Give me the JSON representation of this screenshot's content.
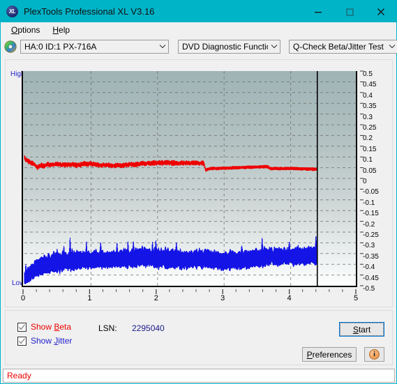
{
  "window": {
    "title": "PlexTools Professional XL V3.16",
    "icon": "XL",
    "icon_name": "plextools-app-icon",
    "accent_color": "#00b4c8",
    "controls": {
      "minimize": "minimize-icon",
      "maximize": "maximize-icon",
      "close": "close-icon"
    }
  },
  "menu": {
    "items": [
      {
        "label": "Options",
        "accel": "O"
      },
      {
        "label": "Help",
        "accel": "H"
      }
    ]
  },
  "toolbar": {
    "disc_icon": "disc-icon",
    "drive_select": {
      "value": "HA:0 ID:1  PX-716A",
      "options": [
        "HA:0 ID:1  PX-716A"
      ]
    },
    "function_select": {
      "value": "DVD Diagnostic Functions",
      "options": [
        "DVD Diagnostic Functions"
      ]
    },
    "test_select": {
      "value": "Q-Check Beta/Jitter Test",
      "options": [
        "Q-Check Beta/Jitter Test"
      ]
    }
  },
  "chart_data": {
    "type": "line",
    "title": "",
    "xlabel": "",
    "ylabel": "",
    "xlim": [
      0,
      5
    ],
    "ylim": [
      -0.5,
      0.5
    ],
    "grid": true,
    "legend": "none",
    "left_axis_labels": {
      "top": "High",
      "bottom": "Low"
    },
    "x_ticks": [
      "0",
      "1",
      "2",
      "3",
      "4",
      "5"
    ],
    "y_ticks": [
      "0.5",
      "0.45",
      "0.4",
      "0.35",
      "0.3",
      "0.25",
      "0.2",
      "0.15",
      "0.1",
      "0.05",
      "0",
      "-0.05",
      "-0.1",
      "-0.15",
      "-0.2",
      "-0.25",
      "-0.3",
      "-0.35",
      "-0.4",
      "-0.45",
      "-0.5"
    ],
    "marker_line_x": 4.4,
    "series": [
      {
        "name": "Beta",
        "color": "#ee0000",
        "x": [
          0.0,
          0.05,
          0.1,
          0.15,
          0.2,
          0.25,
          0.3,
          0.35,
          0.4,
          0.45,
          0.5,
          0.55,
          0.6,
          0.65,
          0.7,
          0.75,
          0.8,
          0.85,
          0.9,
          0.95,
          1.0,
          1.05,
          1.1,
          1.15,
          1.2,
          1.25,
          1.3,
          1.35,
          1.4,
          1.45,
          1.5,
          1.55,
          1.6,
          1.65,
          1.7,
          1.75,
          1.8,
          1.85,
          1.9,
          1.95,
          2.0,
          2.05,
          2.1,
          2.15,
          2.2,
          2.25,
          2.3,
          2.35,
          2.4,
          2.45,
          2.5,
          2.55,
          2.6,
          2.65,
          2.7,
          2.72,
          2.75,
          2.8,
          2.85,
          2.9,
          2.95,
          3.0,
          3.05,
          3.1,
          3.15,
          3.2,
          3.25,
          3.3,
          3.35,
          3.4,
          3.45,
          3.5,
          3.55,
          3.6,
          3.65,
          3.7,
          3.75,
          3.8,
          3.85,
          3.9,
          3.95,
          4.0,
          4.05,
          4.1,
          4.15,
          4.2,
          4.25,
          4.3,
          4.35,
          4.4
        ],
        "y": [
          0.095,
          0.08,
          0.072,
          0.065,
          0.05,
          0.062,
          0.058,
          0.066,
          0.061,
          0.064,
          0.067,
          0.063,
          0.065,
          0.062,
          0.066,
          0.063,
          0.06,
          0.064,
          0.068,
          0.066,
          0.07,
          0.065,
          0.063,
          0.061,
          0.064,
          0.062,
          0.06,
          0.058,
          0.062,
          0.059,
          0.061,
          0.063,
          0.066,
          0.064,
          0.067,
          0.069,
          0.07,
          0.071,
          0.07,
          0.072,
          0.071,
          0.072,
          0.072,
          0.073,
          0.072,
          0.072,
          0.071,
          0.071,
          0.072,
          0.071,
          0.071,
          0.072,
          0.071,
          0.071,
          0.071,
          0.038,
          0.042,
          0.046,
          0.047,
          0.046,
          0.047,
          0.048,
          0.048,
          0.049,
          0.05,
          0.05,
          0.051,
          0.051,
          0.052,
          0.052,
          0.053,
          0.053,
          0.054,
          0.054,
          0.055,
          0.045,
          0.046,
          0.046,
          0.046,
          0.046,
          0.046,
          0.046,
          0.046,
          0.046,
          0.045,
          0.045,
          0.044,
          0.044,
          0.043,
          0.043
        ]
      },
      {
        "name": "Jitter",
        "color": "#1414e6",
        "description": "Dense noise band; values are band center with +/- spread",
        "x": [
          0.0,
          0.1,
          0.2,
          0.3,
          0.4,
          0.5,
          0.6,
          0.7,
          0.8,
          0.9,
          1.0,
          1.1,
          1.2,
          1.3,
          1.4,
          1.5,
          1.6,
          1.7,
          1.8,
          1.9,
          2.0,
          2.1,
          2.2,
          2.3,
          2.4,
          2.5,
          2.6,
          2.7,
          2.8,
          2.9,
          3.0,
          3.1,
          3.2,
          3.3,
          3.4,
          3.5,
          3.6,
          3.7,
          3.8,
          3.9,
          4.0,
          4.1,
          4.2,
          4.3,
          4.4
        ],
        "y": [
          -0.47,
          -0.44,
          -0.42,
          -0.408,
          -0.4,
          -0.396,
          -0.392,
          -0.39,
          -0.386,
          -0.382,
          -0.386,
          -0.384,
          -0.382,
          -0.38,
          -0.38,
          -0.378,
          -0.378,
          -0.372,
          -0.372,
          -0.376,
          -0.378,
          -0.38,
          -0.382,
          -0.38,
          -0.384,
          -0.384,
          -0.38,
          -0.378,
          -0.382,
          -0.386,
          -0.39,
          -0.388,
          -0.386,
          -0.384,
          -0.382,
          -0.378,
          -0.372,
          -0.368,
          -0.368,
          -0.366,
          -0.368,
          -0.366,
          -0.366,
          -0.364,
          -0.362
        ],
        "spread": [
          0.03,
          0.04,
          0.042,
          0.044,
          0.046,
          0.046,
          0.046,
          0.05,
          0.046,
          0.044,
          0.046,
          0.046,
          0.044,
          0.044,
          0.046,
          0.046,
          0.046,
          0.05,
          0.046,
          0.044,
          0.046,
          0.048,
          0.046,
          0.046,
          0.044,
          0.044,
          0.046,
          0.046,
          0.046,
          0.044,
          0.044,
          0.046,
          0.046,
          0.044,
          0.044,
          0.046,
          0.046,
          0.044,
          0.042,
          0.042,
          0.042,
          0.044,
          0.042,
          0.042,
          0.044
        ]
      }
    ]
  },
  "controls": {
    "show_beta": {
      "label_prefix": "Show ",
      "label_accel": "B",
      "label_suffix": "eta",
      "checked": true,
      "color": "#ee0000"
    },
    "show_jitter": {
      "label_prefix": "Show ",
      "label_accel": "J",
      "label_suffix": "itter",
      "checked": true,
      "color": "#2222cc"
    },
    "lsn_label": "LSN:",
    "lsn_value": "2295040",
    "start_button": {
      "prefix": "",
      "accel": "S",
      "suffix": "tart",
      "focused": true
    },
    "preferences_button": {
      "prefix": "",
      "accel": "P",
      "suffix": "references"
    },
    "info_button": {
      "glyph": "i",
      "name": "info-icon"
    }
  },
  "statusbar": {
    "text": "Ready",
    "color": "#ee0000"
  }
}
